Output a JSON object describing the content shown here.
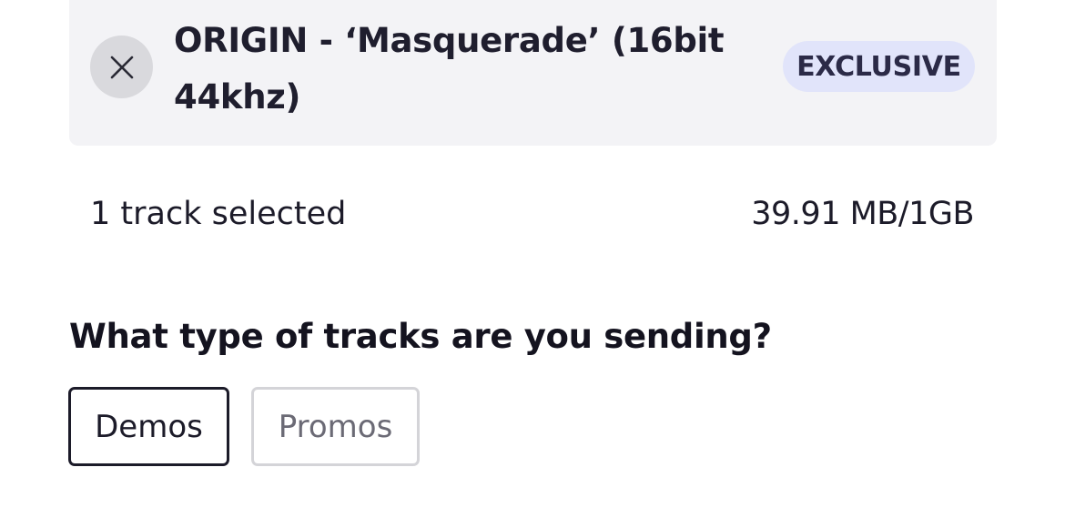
{
  "track": {
    "title": "ORIGIN - ‘Masquerade’ (16bit 44khz)",
    "badge": "EXCLUSIVE",
    "remove_icon": "close-icon"
  },
  "selection": {
    "count_text": "1 track selected",
    "size_text": "39.91 MB/1GB"
  },
  "track_type": {
    "question": "What type of tracks are you sending?",
    "options": [
      {
        "label": "Demos",
        "selected": true
      },
      {
        "label": "Promos",
        "selected": false
      }
    ]
  },
  "colors": {
    "card_background": "#f3f3f6",
    "badge_background": "#e1e4fa",
    "text_primary": "#1c1b29",
    "unselected_border": "#d4d4d8",
    "unselected_text": "#6b6a75"
  }
}
